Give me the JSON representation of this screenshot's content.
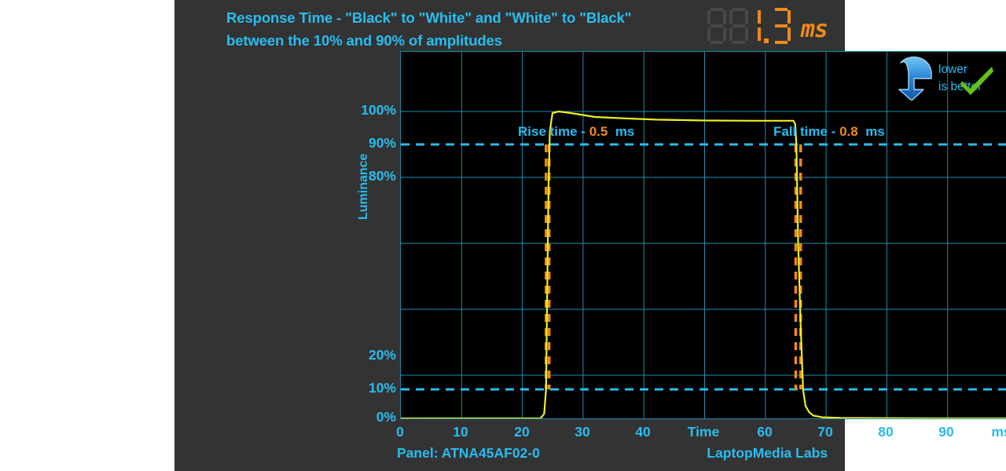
{
  "title": {
    "line1": "Response Time - \"Black\" to \"White\" and \"White\" to \"Black\"",
    "line2": "between the 10% and 90% of amplitudes"
  },
  "readout": {
    "value": "1.3",
    "unit": "ms",
    "ghost": "88"
  },
  "badge": {
    "line1": "lower",
    "line2": "is better",
    "arrow_icon": "curved-down-arrow-icon",
    "check_icon": "green-check-icon"
  },
  "annotations": {
    "rise": {
      "label": "Rise time -",
      "value": "0.5",
      "unit": "ms"
    },
    "fall": {
      "label": "Fall time -",
      "value": "0.8",
      "unit": "ms"
    }
  },
  "footer": {
    "panel": "Panel: ATNA45AF02-0",
    "lab": "LaptopMedia Labs"
  },
  "colors": {
    "accent": "#29bdef",
    "orange": "#f08a18",
    "trace": "#eeee22",
    "grid": "#1a8fae",
    "panel_bg": "#333333",
    "plot_bg": "#000000"
  },
  "chart_data": {
    "type": "line",
    "title": "Response Time - \"Black\" to \"White\" and \"White\" to \"Black\" between the 10% and 90% of amplitudes",
    "xlabel": "Time",
    "ylabel": "Luminance",
    "x_unit": "ms",
    "y_unit": "%",
    "xlim": [
      0,
      100
    ],
    "ylim": [
      0,
      110
    ],
    "grid": true,
    "legend": "none",
    "xticks": [
      0,
      10,
      20,
      30,
      40,
      60,
      70,
      80,
      90
    ],
    "xticklabels": [
      "0",
      "10",
      "20",
      "30",
      "40",
      "60",
      "70",
      "80",
      "90"
    ],
    "xtick_center_label": "Time",
    "xtick_end_label": "ms",
    "yticks": [
      0,
      10,
      20,
      80,
      90,
      100
    ],
    "yticklabels": [
      "0%",
      "10%",
      "20%",
      "80%",
      "90%",
      "100%"
    ],
    "threshold_lines": [
      {
        "y": 90,
        "style": "dashed",
        "color": "#29bdef"
      },
      {
        "y": 10,
        "style": "dashed",
        "color": "#29bdef"
      }
    ],
    "markers": [
      {
        "x": 23.9,
        "style": "dashed",
        "color": "#f08a18",
        "y_from": 10,
        "y_to": 90
      },
      {
        "x": 24.4,
        "style": "dashed",
        "color": "#f08a18",
        "y_from": 10,
        "y_to": 90
      },
      {
        "x": 65.0,
        "style": "dashed",
        "color": "#f08a18",
        "y_from": 10,
        "y_to": 90
      },
      {
        "x": 65.8,
        "style": "dashed",
        "color": "#f08a18",
        "y_from": 10,
        "y_to": 90
      }
    ],
    "measurements": [
      {
        "name": "Rise time",
        "value": 0.5,
        "unit": "ms"
      },
      {
        "name": "Fall time",
        "value": 0.8,
        "unit": "ms"
      },
      {
        "name": "Total response time",
        "value": 1.3,
        "unit": "ms"
      }
    ],
    "series": [
      {
        "name": "Luminance",
        "color": "#eeee22",
        "x": [
          0,
          5,
          10,
          15,
          20,
          23.0,
          23.6,
          23.9,
          24.1,
          24.3,
          24.5,
          25.0,
          26.0,
          28.0,
          32.0,
          36.0,
          42.0,
          50.0,
          58.0,
          63.0,
          64.6,
          64.9,
          65.1,
          65.4,
          65.8,
          66.2,
          66.8,
          67.5,
          69.0,
          72.0,
          78.0,
          85.0,
          92.0,
          100
        ],
        "y": [
          0,
          0,
          0,
          0,
          0,
          0,
          1.5,
          10,
          45,
          80,
          95,
          101.5,
          102.0,
          101.5,
          100.6,
          100.2,
          99.7,
          99.4,
          99.3,
          99.3,
          99.3,
          98.0,
          90,
          55,
          22,
          10,
          4.5,
          2.0,
          0.9,
          0.4,
          0.2,
          0.1,
          0.05,
          0
        ]
      }
    ]
  }
}
